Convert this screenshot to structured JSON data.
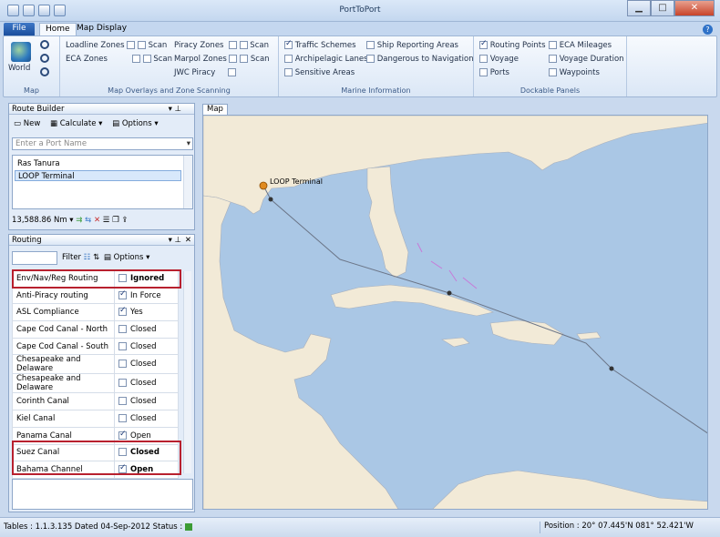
{
  "app": {
    "title": "PortToPort"
  },
  "window": {
    "minimize": "▁",
    "maximize": "□",
    "close": "✕"
  },
  "tabs": {
    "file": "File",
    "home": "Home",
    "map_display": "Map Display"
  },
  "ribbon": {
    "map": {
      "world_label": "World",
      "group_label": "Map"
    },
    "overlays": {
      "loadline": "Loadline Zones",
      "eca": "ECA Zones",
      "piracy": "Piracy Zones",
      "marpol": "Marpol Zones",
      "jwc": "JWC Piracy",
      "scan": "Scan",
      "group_label": "Map Overlays and Zone Scanning"
    },
    "marine": {
      "traffic": "Traffic Schemes",
      "archipelagic": "Archipelagic Lanes",
      "sensitive": "Sensitive Areas",
      "ship_reporting": "Ship Reporting Areas",
      "danger": "Dangerous to Navigation",
      "group_label": "Marine Information"
    },
    "dockable": {
      "routing_points": "Routing Points",
      "voyage": "Voyage",
      "ports": "Ports",
      "eca_mileages": "ECA Mileages",
      "voyage_duration": "Voyage Duration",
      "waypoints": "Waypoints",
      "group_label": "Dockable Panels"
    }
  },
  "route_builder": {
    "title": "Route Builder",
    "new": "New",
    "calculate": "Calculate ▾",
    "options": "Options ▾",
    "port_placeholder": "Enter a Port Name",
    "ports": [
      "Ras Tanura",
      "LOOP Terminal"
    ],
    "distance": "13,588.86 Nm ▾"
  },
  "routing": {
    "title": "Routing",
    "filter": "Filter",
    "options": "Options ▾",
    "rows": [
      {
        "name": "Env/Nav/Reg Routing",
        "checked": false,
        "status": "Ignored",
        "bold": true
      },
      {
        "name": "Anti-Piracy routing",
        "checked": true,
        "status": "In Force",
        "bold": false
      },
      {
        "name": "ASL Compliance",
        "checked": true,
        "status": "Yes",
        "bold": false
      },
      {
        "name": "Cape Cod Canal - North",
        "checked": false,
        "status": "Closed",
        "bold": false
      },
      {
        "name": "Cape Cod Canal - South",
        "checked": false,
        "status": "Closed",
        "bold": false
      },
      {
        "name": "Chesapeake and Delaware",
        "checked": false,
        "status": "Closed",
        "bold": false
      },
      {
        "name": "Chesapeake and Delaware",
        "checked": false,
        "status": "Closed",
        "bold": false
      },
      {
        "name": "Corinth Canal",
        "checked": false,
        "status": "Closed",
        "bold": false
      },
      {
        "name": "Kiel Canal",
        "checked": false,
        "status": "Closed",
        "bold": false
      },
      {
        "name": "Panama Canal",
        "checked": true,
        "status": "Open",
        "bold": false
      },
      {
        "name": "Suez Canal",
        "checked": false,
        "status": "Closed",
        "bold": true
      },
      {
        "name": "Bahama Channel",
        "checked": true,
        "status": "Open",
        "bold": true
      }
    ]
  },
  "map": {
    "tab": "Map",
    "port_label": "LOOP Terminal"
  },
  "status": {
    "tables": "Tables : 1.1.3.135 Dated 04-Sep-2012  Status :",
    "position": "Position :  20° 07.445'N 081° 52.421'W"
  }
}
